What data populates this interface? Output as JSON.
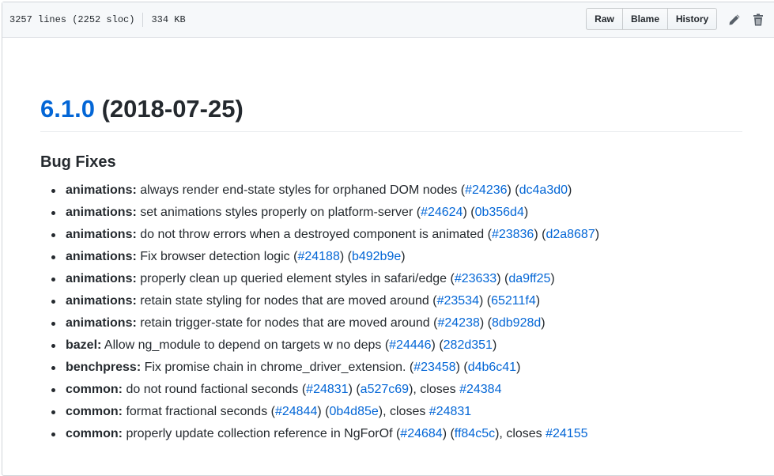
{
  "file_header": {
    "lines": "3257 lines (2252 sloc)",
    "size": "334 KB",
    "buttons": {
      "raw": "Raw",
      "blame": "Blame",
      "history": "History"
    }
  },
  "release": {
    "version": "6.1.0",
    "date": "(2018-07-25)"
  },
  "section_title": "Bug Fixes",
  "items": [
    {
      "scope": "animations:",
      "text": "always render end-state styles for orphaned DOM nodes",
      "pr": "#24236",
      "commit": "dc4a3d0",
      "closes": ""
    },
    {
      "scope": "animations:",
      "text": "set animations styles properly on platform-server",
      "pr": "#24624",
      "commit": "0b356d4",
      "closes": ""
    },
    {
      "scope": "animations:",
      "text": "do not throw errors when a destroyed component is animated",
      "pr": "#23836",
      "commit": "d2a8687",
      "closes": ""
    },
    {
      "scope": "animations:",
      "text": "Fix browser detection logic",
      "pr": "#24188",
      "commit": "b492b9e",
      "closes": ""
    },
    {
      "scope": "animations:",
      "text": "properly clean up queried element styles in safari/edge",
      "pr": "#23633",
      "commit": "da9ff25",
      "closes": ""
    },
    {
      "scope": "animations:",
      "text": "retain state styling for nodes that are moved around",
      "pr": "#23534",
      "commit": "65211f4",
      "closes": ""
    },
    {
      "scope": "animations:",
      "text": "retain trigger-state for nodes that are moved around",
      "pr": "#24238",
      "commit": "8db928d",
      "closes": ""
    },
    {
      "scope": "bazel:",
      "text": "Allow ng_module to depend on targets w no deps",
      "pr": "#24446",
      "commit": "282d351",
      "closes": ""
    },
    {
      "scope": "benchpress:",
      "text": "Fix promise chain in chrome_driver_extension.",
      "pr": "#23458",
      "commit": "d4b6c41",
      "closes": ""
    },
    {
      "scope": "common:",
      "text": "do not round factional seconds",
      "pr": "#24831",
      "commit": "a527c69",
      "closes": "#24384"
    },
    {
      "scope": "common:",
      "text": "format fractional seconds",
      "pr": "#24844",
      "commit": "0b4d85e",
      "closes": "#24831"
    },
    {
      "scope": "common:",
      "text": "properly update collection reference in NgForOf",
      "pr": "#24684",
      "commit": "ff84c5c",
      "closes": "#24155"
    }
  ],
  "icons": {
    "edit": "pencil-icon",
    "delete": "trash-icon"
  },
  "colors": {
    "link": "#0366d6",
    "text": "#24292e",
    "header_bg": "#f6f8fa"
  }
}
